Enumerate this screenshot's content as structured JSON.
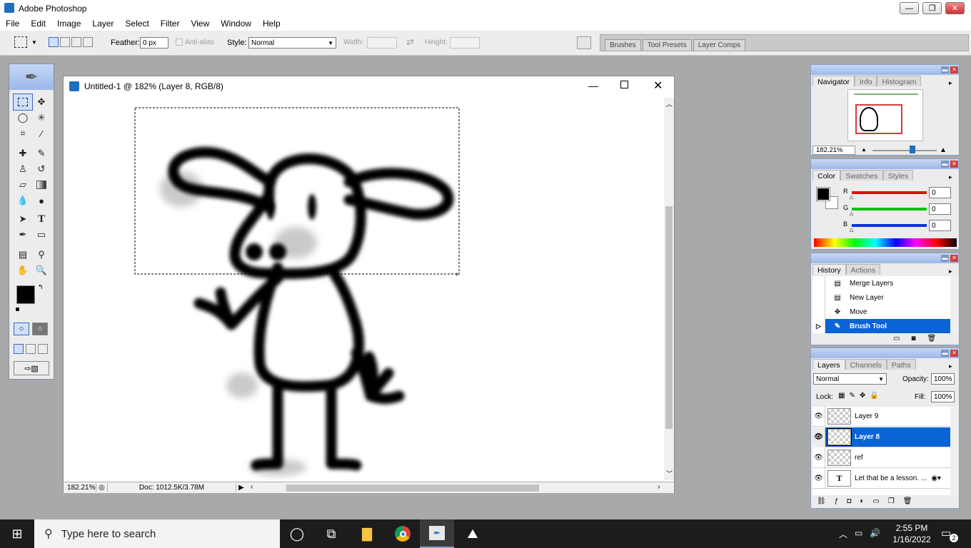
{
  "app": {
    "title": "Adobe Photoshop",
    "minimize_glyph": "—",
    "restore_glyph": "❐",
    "close_glyph": "✕"
  },
  "menu": [
    "File",
    "Edit",
    "Image",
    "Layer",
    "Select",
    "Filter",
    "View",
    "Window",
    "Help"
  ],
  "options": {
    "feather_label": "Feather:",
    "feather_value": "0 px",
    "antialias_label": "Anti-alias",
    "style_label": "Style:",
    "style_value": "Normal",
    "width_label": "Width:",
    "height_label": "Height:",
    "well_tabs": [
      "Brushes",
      "Tool Presets",
      "Layer Comps"
    ]
  },
  "document": {
    "title": "Untitled-1 @ 182% (Layer 8, RGB/8)",
    "zoom": "182.21%",
    "doc_info": "Doc: 1012.5K/3.78M"
  },
  "navigator": {
    "tabs": [
      "Navigator",
      "Info",
      "Histogram"
    ],
    "zoom": "182.21%",
    "zoom_fraction": 0.62
  },
  "color": {
    "tabs": [
      "Color",
      "Swatches",
      "Styles"
    ],
    "channels": [
      {
        "label": "R",
        "value": "0",
        "color": "#e01010"
      },
      {
        "label": "G",
        "value": "0",
        "color": "#10c010"
      },
      {
        "label": "B",
        "value": "0",
        "color": "#1030e0"
      }
    ]
  },
  "history": {
    "tabs": [
      "History",
      "Actions"
    ],
    "items": [
      "Merge Layers",
      "New Layer",
      "Move",
      "Brush Tool"
    ],
    "selected_index": 3
  },
  "layers": {
    "tabs": [
      "Layers",
      "Channels",
      "Paths"
    ],
    "blend_mode": "Normal",
    "opacity_label": "Opacity:",
    "opacity_value": "100%",
    "lock_label": "Lock:",
    "fill_label": "Fill:",
    "fill_value": "100%",
    "items": [
      "Layer 9",
      "Layer 8",
      "ref",
      "Let that be a lesson. ..."
    ],
    "selected_index": 1,
    "text_layer_glyph": "T"
  },
  "taskbar": {
    "search_placeholder": "Type here to search",
    "time": "2:55 PM",
    "date": "1/16/2022",
    "notification_count": "2"
  },
  "colors": {
    "accent": "#0a64d6",
    "selection": "#0a64d6",
    "taskbar": "#1c1c1c"
  }
}
